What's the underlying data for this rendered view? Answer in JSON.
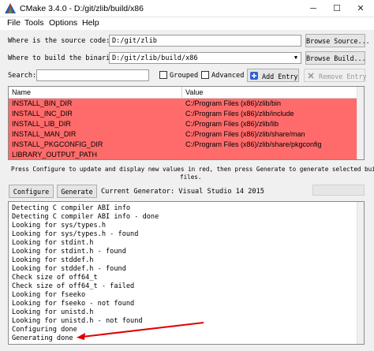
{
  "window": {
    "title": "CMake 3.4.0 - D:/git/zlib/build/x86",
    "minimize_glyph": "─",
    "maximize_glyph": "☐",
    "close_glyph": "✕"
  },
  "menu": {
    "file": "File",
    "tools": "Tools",
    "options": "Options",
    "help": "Help"
  },
  "source": {
    "label": "Where is the source code:",
    "value": "D:/git/zlib",
    "browse_label": "Browse Source..."
  },
  "build": {
    "label": "Where to build the binaries:",
    "value": "D:/git/zlib/build/x86",
    "browse_label": "Browse Build..."
  },
  "search": {
    "label": "Search:",
    "value": "",
    "grouped_label": "Grouped",
    "grouped_checked": false,
    "advanced_label": "Advanced",
    "advanced_checked": false,
    "add_entry_label": "Add Entry",
    "remove_entry_label": "Remove Entry"
  },
  "table": {
    "headers": {
      "name": "Name",
      "value": "Value"
    },
    "highlight_color": "#ff6b6b",
    "rows": [
      {
        "name": "INSTALL_BIN_DIR",
        "value": "C:/Program Files (x86)/zlib/bin"
      },
      {
        "name": "INSTALL_INC_DIR",
        "value": "C:/Program Files (x86)/zlib/include"
      },
      {
        "name": "INSTALL_LIB_DIR",
        "value": "C:/Program Files (x86)/zlib/lib"
      },
      {
        "name": "INSTALL_MAN_DIR",
        "value": "C:/Program Files (x86)/zlib/share/man"
      },
      {
        "name": "INSTALL_PKGCONFIG_DIR",
        "value": "C:/Program Files (x86)/zlib/share/pkgconfig"
      },
      {
        "name": "LIBRARY_OUTPUT_PATH",
        "value": ""
      }
    ]
  },
  "hint": {
    "line1": "Press Configure to update and display new values in red, then press Generate to generate selected build",
    "line2": "files."
  },
  "actions": {
    "configure_label": "Configure",
    "generate_label": "Generate",
    "current_generator": "Current Generator: Visual Studio 14 2015"
  },
  "log": {
    "lines": [
      "Detecting C compiler ABI info",
      "Detecting C compiler ABI info - done",
      "Looking for sys/types.h",
      "Looking for sys/types.h - found",
      "Looking for stdint.h",
      "Looking for stdint.h - found",
      "Looking for stddef.h",
      "Looking for stddef.h - found",
      "Check size of off64_t",
      "Check size of off64_t - failed",
      "Looking for fseeko",
      "Looking for fseeko - not found",
      "Looking for unistd.h",
      "Looking for unistd.h - not found",
      "Configuring done",
      "Generating done"
    ]
  },
  "annotation": {
    "arrow_color": "#e00000"
  }
}
